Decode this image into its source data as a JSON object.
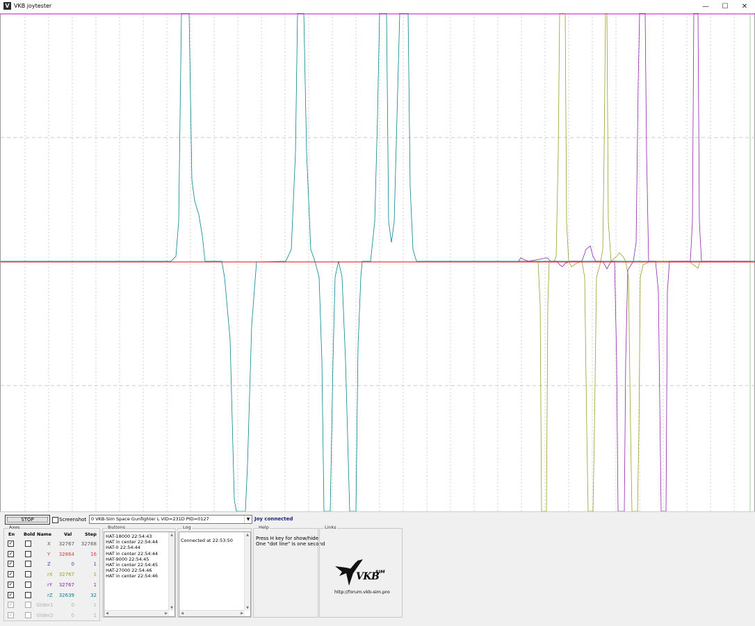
{
  "window": {
    "title": "VKB joytester",
    "minimize_glyph": "—",
    "maximize_glyph": "☐",
    "close_glyph": "✕",
    "icon": "vkb-app-icon"
  },
  "toolbar": {
    "stop_label": "STOP",
    "screenshot_label": "Screenshot",
    "device_select": "0  VKB-Sim Space Gunfighter L  VID=231D PID=0127",
    "status": "Joy connected"
  },
  "axes_panel": {
    "title": "Axes",
    "headers": {
      "en": "En",
      "bold": "Bold",
      "name": "Name",
      "val": "Val",
      "step": "Step"
    },
    "rows": [
      {
        "name": "X",
        "val": "32767",
        "step": "32768",
        "en": true,
        "bold": false,
        "color": "#555555"
      },
      {
        "name": "Y",
        "val": "32864",
        "step": "16",
        "en": true,
        "bold": false,
        "color": "#e53935"
      },
      {
        "name": "Z",
        "val": "0",
        "step": "1",
        "en": true,
        "bold": false,
        "color": "#3949ab"
      },
      {
        "name": "rX",
        "val": "32767",
        "step": "1",
        "en": true,
        "bold": false,
        "color": "#9e9d24"
      },
      {
        "name": "rY",
        "val": "32767",
        "step": "1",
        "en": true,
        "bold": false,
        "color": "#8e24aa"
      },
      {
        "name": "rZ",
        "val": "32639",
        "step": "32",
        "en": true,
        "bold": false,
        "color": "#00838f"
      },
      {
        "name": "Slider1",
        "val": "0",
        "step": "1",
        "en": true,
        "bold": false,
        "color": "#b0b0b0",
        "disabled": true
      },
      {
        "name": "Slider2",
        "val": "0",
        "step": "1",
        "en": true,
        "bold": false,
        "color": "#b0b0b0",
        "disabled": true
      }
    ]
  },
  "buttons_panel": {
    "title": "Buttons",
    "lines": [
      "HAT-18000 22:54:43",
      "HAT in center 22:54:44",
      "HAT-0 22:54:44",
      "HAT in center 22:54:44",
      "HAT-9000 22:54:45",
      "HAT in center 22:54:45",
      "HAT-27000 22:54:46",
      "HAT in center 22:54:46"
    ]
  },
  "log_panel": {
    "title": "Log",
    "lines": [
      "Connected at 22:53:50"
    ]
  },
  "help_panel": {
    "title": "Help",
    "lines": [
      "Press H key for show/hide",
      "One \"dot line\" is one second"
    ]
  },
  "links_panel": {
    "title": "Links",
    "logo_text": "VKB",
    "logo_sup": "SIM",
    "url": "http://forum.vkb-sim.pro"
  },
  "plot": {
    "colors": {
      "x": "#555555",
      "y": "#e53935",
      "rx": "#9e9d24",
      "ry": "#8e24aa",
      "rz": "#00838f",
      "border": "#d400d4"
    }
  }
}
